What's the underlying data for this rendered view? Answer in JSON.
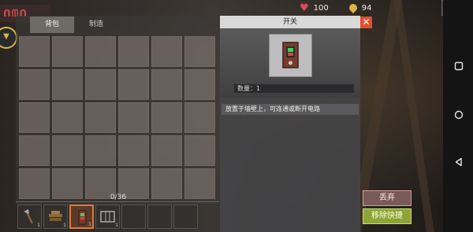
{
  "hud": {
    "health_icon": "heart-icon",
    "health_value": "100",
    "currency_icon": "location-pin-icon",
    "currency_value": "94",
    "power_icon": "power-icon"
  },
  "inventory": {
    "tabs": [
      {
        "label": "背包",
        "active": true
      },
      {
        "label": "制造",
        "active": false
      }
    ],
    "grid_rows": 5,
    "grid_cols": 6,
    "count_label": "0/36"
  },
  "hotbar": {
    "slots": [
      {
        "item": "axe-icon",
        "qty": "1",
        "active": false
      },
      {
        "item": "wood-pile-icon",
        "qty": "1",
        "active": false
      },
      {
        "item": "switch-icon",
        "qty": "1",
        "active": true
      },
      {
        "item": "fence-icon",
        "qty": "1",
        "active": false
      },
      {
        "item": "",
        "qty": "",
        "active": false
      },
      {
        "item": "",
        "qty": "",
        "active": false
      },
      {
        "item": "",
        "qty": "",
        "active": false
      }
    ]
  },
  "detail": {
    "title": "开关",
    "close_label": "✕",
    "quantity_label": "数量：1",
    "description": "放置于墙壁上，可连通或断开电路"
  },
  "actions": {
    "drop_label": "丢弃",
    "remove_shortcut_label": "移除快捷"
  },
  "colors": {
    "accent_orange": "#e07a3a",
    "close_red": "#e0502a",
    "drop_button": "#7a5a58",
    "remove_button": "#8fa336",
    "health": "#e04b5a",
    "currency": "#d9b54a"
  }
}
